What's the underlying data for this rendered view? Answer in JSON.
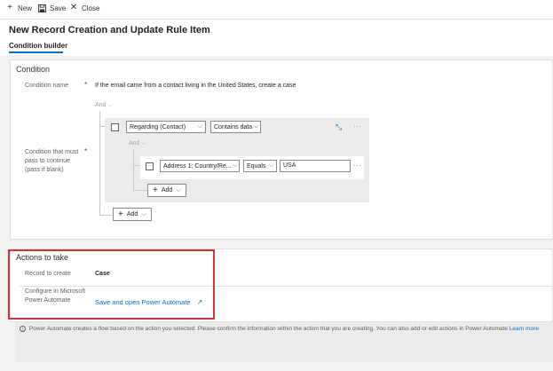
{
  "toolbar": {
    "new_label": "New",
    "save_label": "Save",
    "close_label": "Close",
    "new_icon": "plus-icon",
    "save_icon": "floppy-disk-icon",
    "close_icon": "close-icon"
  },
  "page": {
    "title": "New Record Creation and Update Rule Item",
    "tab_label": "Condition builder"
  },
  "condition": {
    "section_title": "Condition",
    "name_label": "Condition name",
    "name_value": "If the email came from a contact living in the United States, create a case",
    "required_mark": "*",
    "continue_label": "Condition that must pass to continue (pass if blank)",
    "root_and": "And",
    "group": {
      "field": "Regarding (Contact)",
      "operator": "Contains data",
      "and_label": "And",
      "row": {
        "field": "Address 1: Country/Re...",
        "operator": "Equals",
        "value": "USA"
      },
      "add_label": "Add"
    },
    "add_label": "Add"
  },
  "actions": {
    "section_title": "Actions to take",
    "record_label": "Record to create",
    "record_value": "Case",
    "configure_label": "Configure in Microsoft Power Automate",
    "link_label": "Save and open Power Automate"
  },
  "info": {
    "text": "Power Automate creates a flow based on the action you selected. Please confirm the information within the action that you are creating. You can also add or edit actions in Power Automate",
    "learn_more": "Learn more"
  },
  "colors": {
    "accent": "#0f6cbd",
    "highlight_box": "#d13438",
    "required": "#a4262c"
  }
}
